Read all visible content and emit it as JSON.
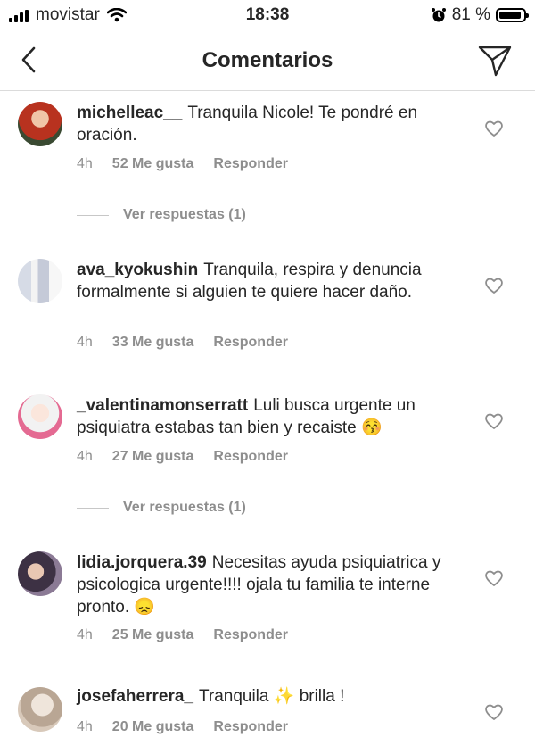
{
  "status_bar": {
    "carrier": "movistar",
    "time": "18:38",
    "battery": "81 %"
  },
  "header": {
    "title": "Comentarios"
  },
  "comments": [
    {
      "username": "michelleac__",
      "text": "Tranquila Nicole! Te pondré en oración.",
      "time": "4h",
      "likes": "52 Me gusta",
      "reply_label": "Responder",
      "view_replies": "Ver respuestas (1)",
      "avatar_color": "#c2412f"
    },
    {
      "username": "ava_kyokushin",
      "text": "Tranquila, respira y denuncia formalmente si alguien te quiere hacer daño.",
      "time": "4h",
      "likes": "33 Me gusta",
      "reply_label": "Responder",
      "avatar_color": "#9aa3c4"
    },
    {
      "username": "_valentinamonserratt",
      "text": "Luli busca urgente un psiquiatra estabas tan bien y recaiste 😚",
      "time": "4h",
      "likes": "27 Me gusta",
      "reply_label": "Responder",
      "view_replies": "Ver respuestas (1)",
      "avatar_color": "#e7a5b6"
    },
    {
      "username": "lidia.jorquera.39",
      "text": "Necesitas ayuda psiquiatrica y psicologica urgente!!!! ojala tu familia te interne pronto. 😞",
      "time": "4h",
      "likes": "25 Me gusta",
      "reply_label": "Responder",
      "avatar_color": "#5a4c63"
    },
    {
      "username": "josefaherrera_",
      "text": "Tranquila ✨ brilla !",
      "time": "4h",
      "likes": "20 Me gusta",
      "reply_label": "Responder",
      "avatar_color": "#c9b9a8"
    }
  ]
}
